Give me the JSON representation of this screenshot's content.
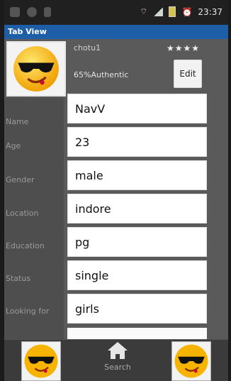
{
  "status_bar": {
    "time": "23:37",
    "icons": [
      "mail-icon",
      "sync-icon",
      "usb-icon",
      "wifi-icon",
      "signal-icon",
      "battery-icon",
      "alarm-icon"
    ]
  },
  "app": {
    "title": "Tab View"
  },
  "profile": {
    "username": "chotu1",
    "stars": "★★★★",
    "authenticity": "65%Authentic",
    "edit_label": "Edit"
  },
  "fields": [
    {
      "label": "Name",
      "value": "NavV"
    },
    {
      "label": "Age",
      "value": "23"
    },
    {
      "label": "Gender",
      "value": "male"
    },
    {
      "label": "Location",
      "value": "indore"
    },
    {
      "label": "Education",
      "value": "pg"
    },
    {
      "label": "Status",
      "value": "single"
    },
    {
      "label": "Looking for",
      "value": "girls"
    }
  ],
  "bottom_tabs": {
    "left_icon": "emoji-sunglasses-icon",
    "center_icon": "home-icon",
    "center_label": "Search",
    "right_icon": "emoji-sunglasses-icon"
  },
  "colors": {
    "title_bar": "#1e5ea6",
    "panel": "#5a5a5a",
    "bottom_bar": "#3b3b3b"
  }
}
